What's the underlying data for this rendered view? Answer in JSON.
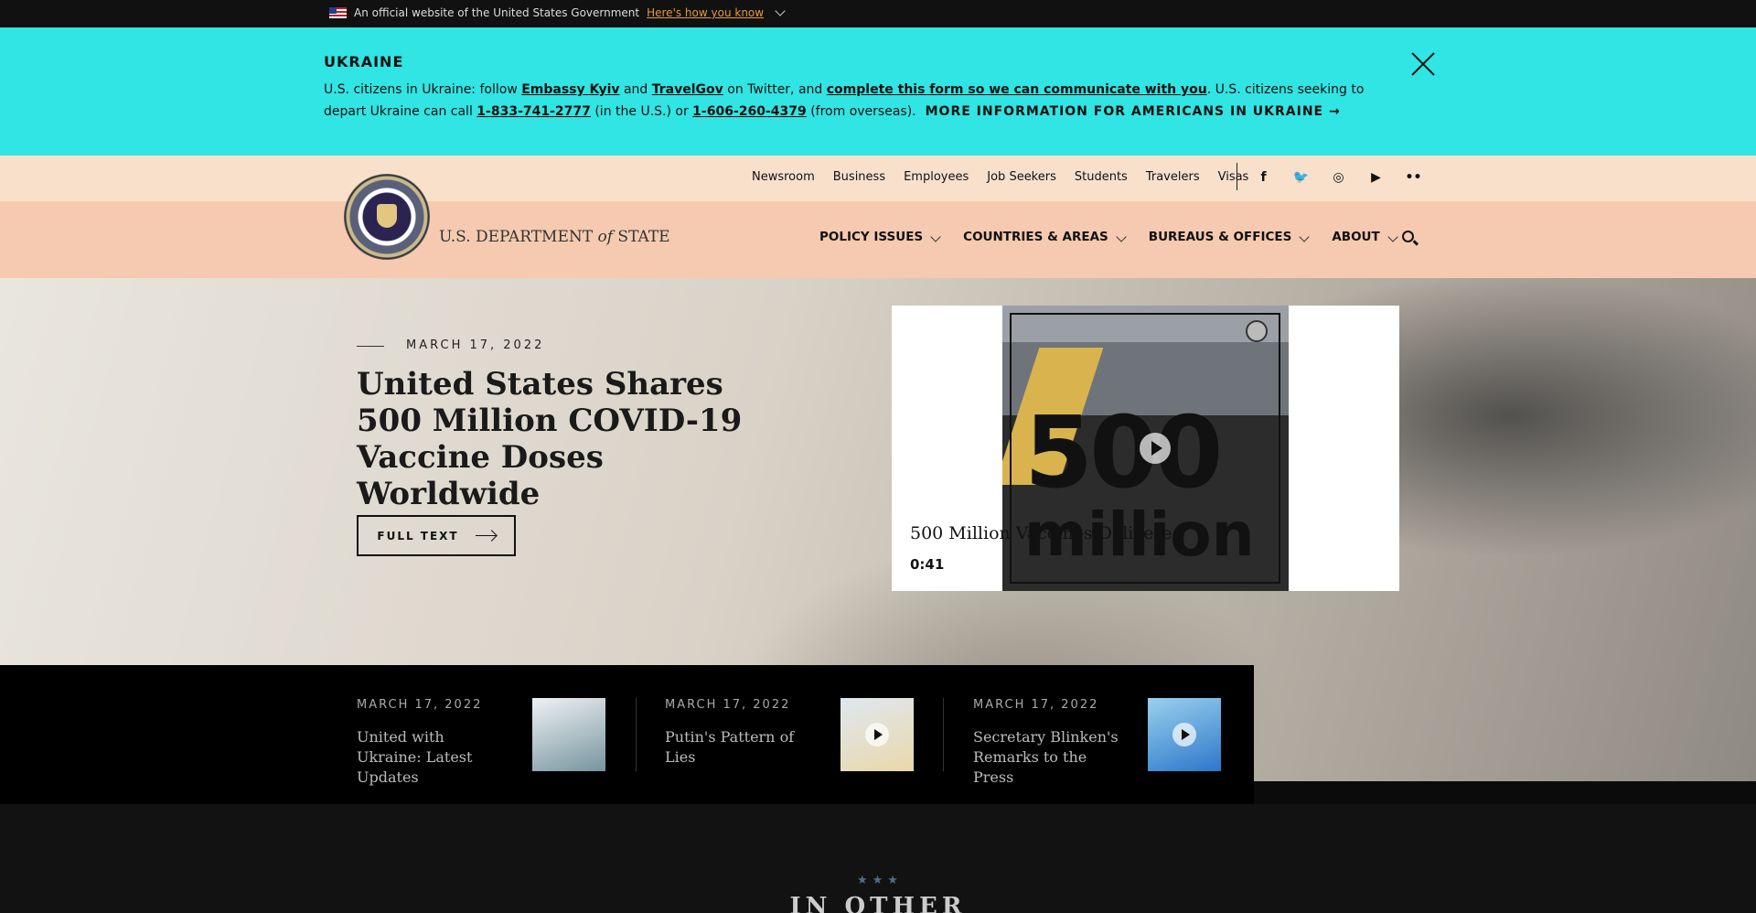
{
  "gov_banner": {
    "text": "An official website of the United States Government",
    "link": "Here's how you know"
  },
  "alert": {
    "title": "UKRAINE",
    "text_1": "U.S. citizens in Ukraine: follow ",
    "link_embassy": "Embassy Kyiv",
    "text_2": " and ",
    "link_travelgov": "TravelGov",
    "text_3": " on Twitter, and ",
    "link_form": "complete this form so we can communicate with you",
    "text_4": ". U.S. citizens seeking to depart Ukraine can call ",
    "phone_us": "1-833-741-2777",
    "text_5": " (in the U.S.) or ",
    "phone_overseas": "1-606-260-4379",
    "text_6": " (from overseas).",
    "more_link": "MORE INFORMATION FOR AMERICANS IN UKRAINE →"
  },
  "utility_nav": [
    "Newsroom",
    "Business",
    "Employees",
    "Job Seekers",
    "Students",
    "Travelers",
    "Visas"
  ],
  "socials": [
    {
      "icon": "facebook-icon",
      "glyph": "f"
    },
    {
      "icon": "twitter-icon",
      "glyph": "🐦"
    },
    {
      "icon": "instagram-icon",
      "glyph": "◎"
    },
    {
      "icon": "youtube-icon",
      "glyph": "▶"
    },
    {
      "icon": "flickr-icon",
      "glyph": "••"
    }
  ],
  "brand": {
    "name_1": "U.S. DEPARTMENT ",
    "name_italic": "of",
    "name_2": " STATE"
  },
  "main_nav": [
    "POLICY ISSUES",
    "COUNTRIES & AREAS",
    "BUREAUS & OFFICES",
    "ABOUT"
  ],
  "hero": {
    "date": "MARCH 17, 2022",
    "title": "United States Shares 500 Million COVID-19 Vaccine Doses Worldwide",
    "button": "FULL TEXT",
    "video": {
      "overlay_big": "500",
      "overlay_small": "million",
      "title": "500 Million Vaccines Delivered",
      "duration": "0:41"
    }
  },
  "featured": [
    {
      "date": "MARCH 17, 2022",
      "title": "United with Ukraine: Latest Updates"
    },
    {
      "date": "MARCH 17, 2022",
      "title": "Putin's Pattern of Lies"
    },
    {
      "date": "MARCH 17, 2022",
      "title": "Secretary Blinken's Remarks to the Press"
    }
  ],
  "other_news": {
    "stars": "★★★",
    "title": "IN OTHER NEWS"
  }
}
